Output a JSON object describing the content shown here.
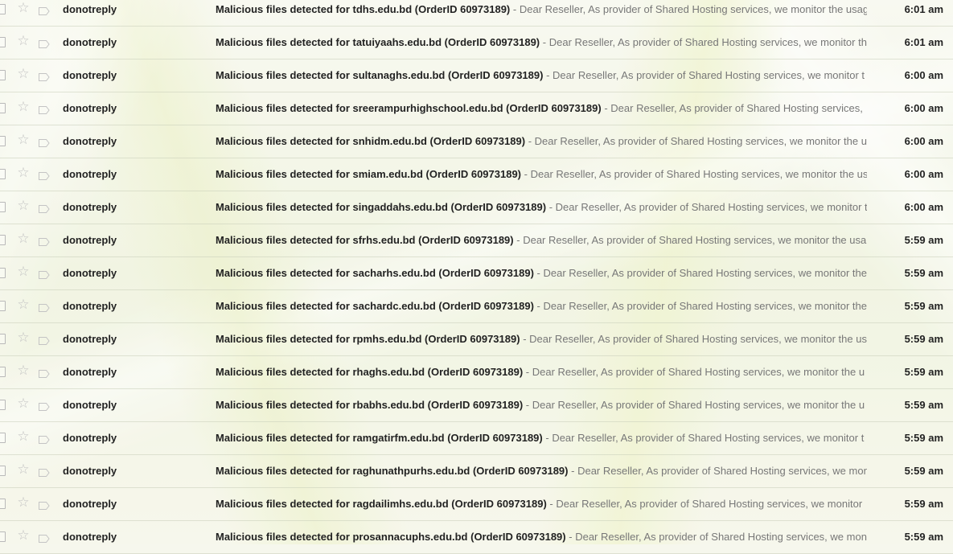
{
  "inbox": {
    "rows": [
      {
        "sender": "donotreply",
        "subject": "Malicious files detected for tdhs.edu.bd (OrderID 60973189)",
        "separator": "-",
        "snippet": "Dear Reseller, As provider of Shared Hosting services, we monitor the usag",
        "time": "6:01 am"
      },
      {
        "sender": "donotreply",
        "subject": "Malicious files detected for tatuiyaahs.edu.bd (OrderID 60973189)",
        "separator": "-",
        "snippet": "Dear Reseller, As provider of Shared Hosting services, we monitor th",
        "time": "6:01 am"
      },
      {
        "sender": "donotreply",
        "subject": "Malicious files detected for sultanaghs.edu.bd (OrderID 60973189)",
        "separator": "-",
        "snippet": "Dear Reseller, As provider of Shared Hosting services, we monitor t",
        "time": "6:00 am"
      },
      {
        "sender": "donotreply",
        "subject": "Malicious files detected for sreerampurhighschool.edu.bd (OrderID 60973189)",
        "separator": "-",
        "snippet": "Dear Reseller, As provider of Shared Hosting services,",
        "time": "6:00 am"
      },
      {
        "sender": "donotreply",
        "subject": "Malicious files detected for snhidm.edu.bd (OrderID 60973189)",
        "separator": "-",
        "snippet": "Dear Reseller, As provider of Shared Hosting services, we monitor the u",
        "time": "6:00 am"
      },
      {
        "sender": "donotreply",
        "subject": "Malicious files detected for smiam.edu.bd (OrderID 60973189)",
        "separator": "-",
        "snippet": "Dear Reseller, As provider of Shared Hosting services, we monitor the us",
        "time": "6:00 am"
      },
      {
        "sender": "donotreply",
        "subject": "Malicious files detected for singaddahs.edu.bd (OrderID 60973189)",
        "separator": "-",
        "snippet": "Dear Reseller, As provider of Shared Hosting services, we monitor t",
        "time": "6:00 am"
      },
      {
        "sender": "donotreply",
        "subject": "Malicious files detected for sfrhs.edu.bd (OrderID 60973189)",
        "separator": "-",
        "snippet": "Dear Reseller, As provider of Shared Hosting services, we monitor the usa",
        "time": "5:59 am"
      },
      {
        "sender": "donotreply",
        "subject": "Malicious files detected for sacharhs.edu.bd (OrderID 60973189)",
        "separator": "-",
        "snippet": "Dear Reseller, As provider of Shared Hosting services, we monitor the",
        "time": "5:59 am"
      },
      {
        "sender": "donotreply",
        "subject": "Malicious files detected for sachardc.edu.bd (OrderID 60973189)",
        "separator": "-",
        "snippet": "Dear Reseller, As provider of Shared Hosting services, we monitor the",
        "time": "5:59 am"
      },
      {
        "sender": "donotreply",
        "subject": "Malicious files detected for rpmhs.edu.bd (OrderID 60973189)",
        "separator": "-",
        "snippet": "Dear Reseller, As provider of Shared Hosting services, we monitor the us",
        "time": "5:59 am"
      },
      {
        "sender": "donotreply",
        "subject": "Malicious files detected for rhaghs.edu.bd (OrderID 60973189)",
        "separator": "-",
        "snippet": "Dear Reseller, As provider of Shared Hosting services, we monitor the u",
        "time": "5:59 am"
      },
      {
        "sender": "donotreply",
        "subject": "Malicious files detected for rbabhs.edu.bd (OrderID 60973189)",
        "separator": "-",
        "snippet": "Dear Reseller, As provider of Shared Hosting services, we monitor the u",
        "time": "5:59 am"
      },
      {
        "sender": "donotreply",
        "subject": "Malicious files detected for ramgatirfm.edu.bd (OrderID 60973189)",
        "separator": "-",
        "snippet": "Dear Reseller, As provider of Shared Hosting services, we monitor t",
        "time": "5:59 am"
      },
      {
        "sender": "donotreply",
        "subject": "Malicious files detected for raghunathpurhs.edu.bd (OrderID 60973189)",
        "separator": "-",
        "snippet": "Dear Reseller, As provider of Shared Hosting services, we mon",
        "time": "5:59 am"
      },
      {
        "sender": "donotreply",
        "subject": "Malicious files detected for ragdailimhs.edu.bd (OrderID 60973189)",
        "separator": "-",
        "snippet": "Dear Reseller, As provider of Shared Hosting services, we monitor",
        "time": "5:59 am"
      },
      {
        "sender": "donotreply",
        "subject": "Malicious files detected for prosannacuphs.edu.bd (OrderID 60973189)",
        "separator": "-",
        "snippet": "Dear Reseller, As provider of Shared Hosting services, we mon",
        "time": "5:59 am"
      }
    ],
    "icons": {
      "checkbox": "checkbox-icon",
      "star": "star-icon",
      "label": "label-tag-icon"
    },
    "colors": {
      "text_bold": "#222222",
      "snippet": "#777777",
      "icon_gray": "#c4c4c4"
    }
  }
}
